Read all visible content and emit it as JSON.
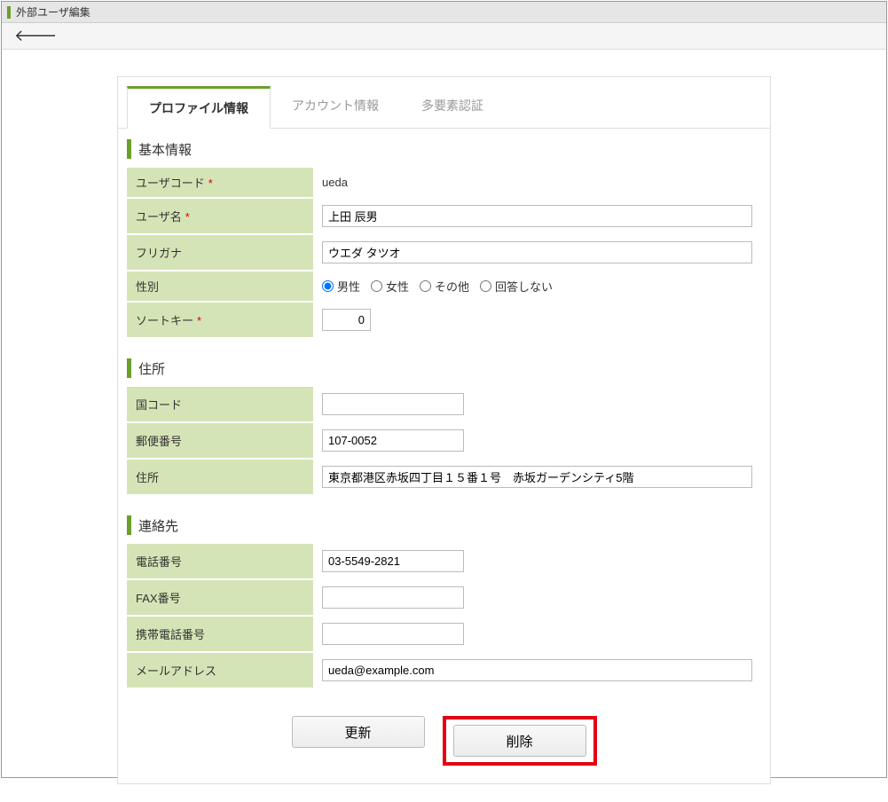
{
  "window": {
    "title": "外部ユーザ編集"
  },
  "tabs": {
    "profile": "プロファイル情報",
    "account": "アカウント情報",
    "mfa": "多要素認証"
  },
  "sections": {
    "basic": "基本情報",
    "address": "住所",
    "contact": "連絡先"
  },
  "labels": {
    "user_code": "ユーザコード",
    "user_name": "ユーザ名",
    "furigana": "フリガナ",
    "gender": "性別",
    "sort_key": "ソートキー",
    "country_code": "国コード",
    "postal_code": "郵便番号",
    "address": "住所",
    "phone": "電話番号",
    "fax": "FAX番号",
    "mobile": "携帯電話番号",
    "email": "メールアドレス"
  },
  "gender_options": {
    "male": "男性",
    "female": "女性",
    "other": "その他",
    "no_answer": "回答しない"
  },
  "values": {
    "user_code": "ueda",
    "user_name": "上田 辰男",
    "furigana": "ウエダ タツオ",
    "gender": "male",
    "sort_key": "0",
    "country_code": "",
    "postal_code": "107-0052",
    "address": "東京都港区赤坂四丁目１５番１号　赤坂ガーデンシティ5階",
    "phone": "03-5549-2821",
    "fax": "",
    "mobile": "",
    "email": "ueda@example.com"
  },
  "buttons": {
    "update": "更新",
    "delete": "削除"
  }
}
